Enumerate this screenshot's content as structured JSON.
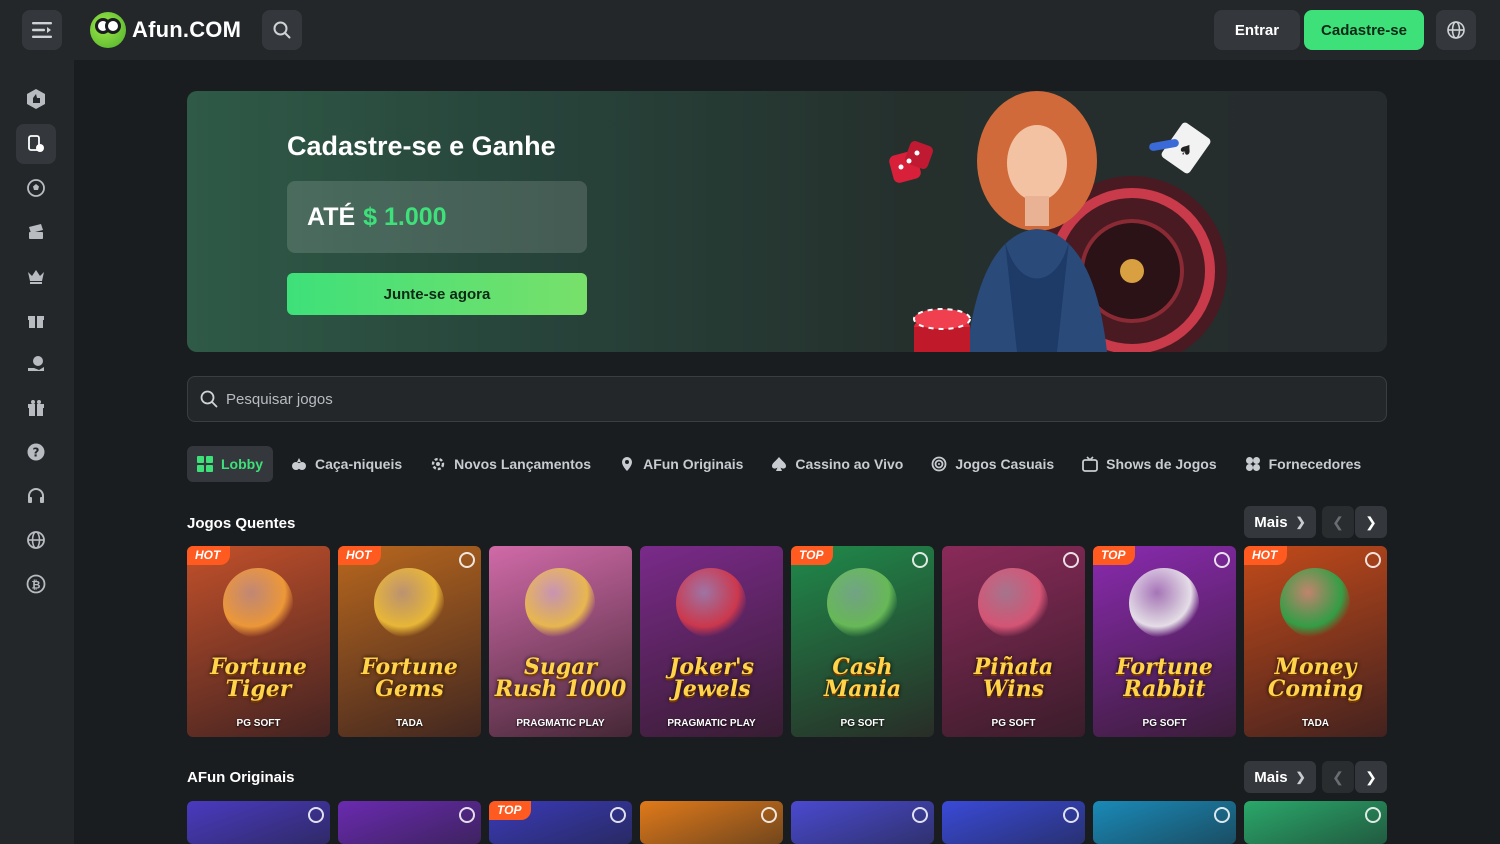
{
  "header": {
    "logo_text": "Afun.COM",
    "login_label": "Entrar",
    "signup_label": "Cadastre-se"
  },
  "sidebar": {
    "items": [
      {
        "name": "sidebar-item-sports",
        "icon": "thumbs-up-icon"
      },
      {
        "name": "sidebar-item-casino",
        "icon": "cards-icon"
      },
      {
        "name": "sidebar-item-football",
        "icon": "soccer-ball-icon"
      },
      {
        "name": "sidebar-item-tickets",
        "icon": "ticket-icon"
      },
      {
        "name": "sidebar-item-vip",
        "icon": "crown-icon"
      },
      {
        "name": "sidebar-item-promotions",
        "icon": "gift-icon"
      },
      {
        "name": "sidebar-item-cashback",
        "icon": "money-hand-icon"
      },
      {
        "name": "sidebar-item-bonus",
        "icon": "gift-box-icon"
      },
      {
        "name": "sidebar-item-help",
        "icon": "question-icon"
      },
      {
        "name": "sidebar-item-support",
        "icon": "headset-icon"
      },
      {
        "name": "sidebar-item-language",
        "icon": "globe-icon"
      },
      {
        "name": "sidebar-item-crypto",
        "icon": "bitcoin-icon"
      }
    ]
  },
  "banner": {
    "title": "Cadastre-se e Ganhe",
    "bonus_prefix": "ATÉ",
    "bonus_amount": "$ 1.000",
    "join_label": "Junte-se agora"
  },
  "search": {
    "placeholder": "Pesquisar jogos"
  },
  "tabs": [
    {
      "label": "Lobby",
      "icon": "grid-icon",
      "active": true
    },
    {
      "label": "Caça-niqueis",
      "icon": "slot-icon",
      "active": false
    },
    {
      "label": "Novos Lançamentos",
      "icon": "gear-icon",
      "active": false
    },
    {
      "label": "AFun Originais",
      "icon": "pin-icon",
      "active": false
    },
    {
      "label": "Cassino ao Vivo",
      "icon": "spade-icon",
      "active": false
    },
    {
      "label": "Jogos Casuais",
      "icon": "target-icon",
      "active": false
    },
    {
      "label": "Shows de Jogos",
      "icon": "tv-icon",
      "active": false
    },
    {
      "label": "Fornecedores",
      "icon": "clover-icon",
      "active": false
    }
  ],
  "sections": {
    "hot": {
      "title": "Jogos Quentes",
      "more_label": "Mais",
      "games": [
        {
          "name": "Fortune Tiger",
          "provider": "PG SOFT",
          "badge": "HOT",
          "bg": "#c2502a",
          "art": "#f6a13a"
        },
        {
          "name": "Fortune Gems",
          "provider": "TADA",
          "badge": "HOT",
          "bg": "#b8671e",
          "art": "#f2c23a"
        },
        {
          "name": "Sugar Rush 1000",
          "provider": "PRAGMATIC PLAY",
          "badge": "",
          "bg": "#d06aa8",
          "art": "#f0c24a"
        },
        {
          "name": "Joker's Jewels",
          "provider": "PRAGMATIC PLAY",
          "badge": "",
          "bg": "#7a2a8a",
          "art": "#d83a4a"
        },
        {
          "name": "Cash Mania",
          "provider": "PG SOFT",
          "badge": "TOP",
          "bg": "#1f8a4a",
          "art": "#6fc15a"
        },
        {
          "name": "Piñata Wins",
          "provider": "PG SOFT",
          "badge": "",
          "bg": "#8a2a5a",
          "art": "#e05a7a"
        },
        {
          "name": "Fortune Rabbit",
          "provider": "PG SOFT",
          "badge": "TOP",
          "bg": "#8a2ab0",
          "art": "#f2f2f2"
        },
        {
          "name": "Money Coming",
          "provider": "TADA",
          "badge": "HOT",
          "bg": "#c24a1a",
          "art": "#2aa84a"
        }
      ]
    },
    "originals": {
      "title": "AFun Originais",
      "more_label": "Mais",
      "games": [
        {
          "badge": "",
          "bg": "#4a3ac0"
        },
        {
          "badge": "",
          "bg": "#6a2ab0"
        },
        {
          "badge": "TOP",
          "bg": "#3a3ab8"
        },
        {
          "badge": "",
          "bg": "#e07a1a"
        },
        {
          "badge": "",
          "bg": "#4a4ad0"
        },
        {
          "badge": "",
          "bg": "#3a4ad8"
        },
        {
          "badge": "",
          "bg": "#1a8ab8"
        },
        {
          "badge": "",
          "bg": "#2aa86a"
        }
      ]
    }
  },
  "colors": {
    "accent": "#3ee07a",
    "background": "#1a1d1f",
    "panel": "#24272a"
  }
}
